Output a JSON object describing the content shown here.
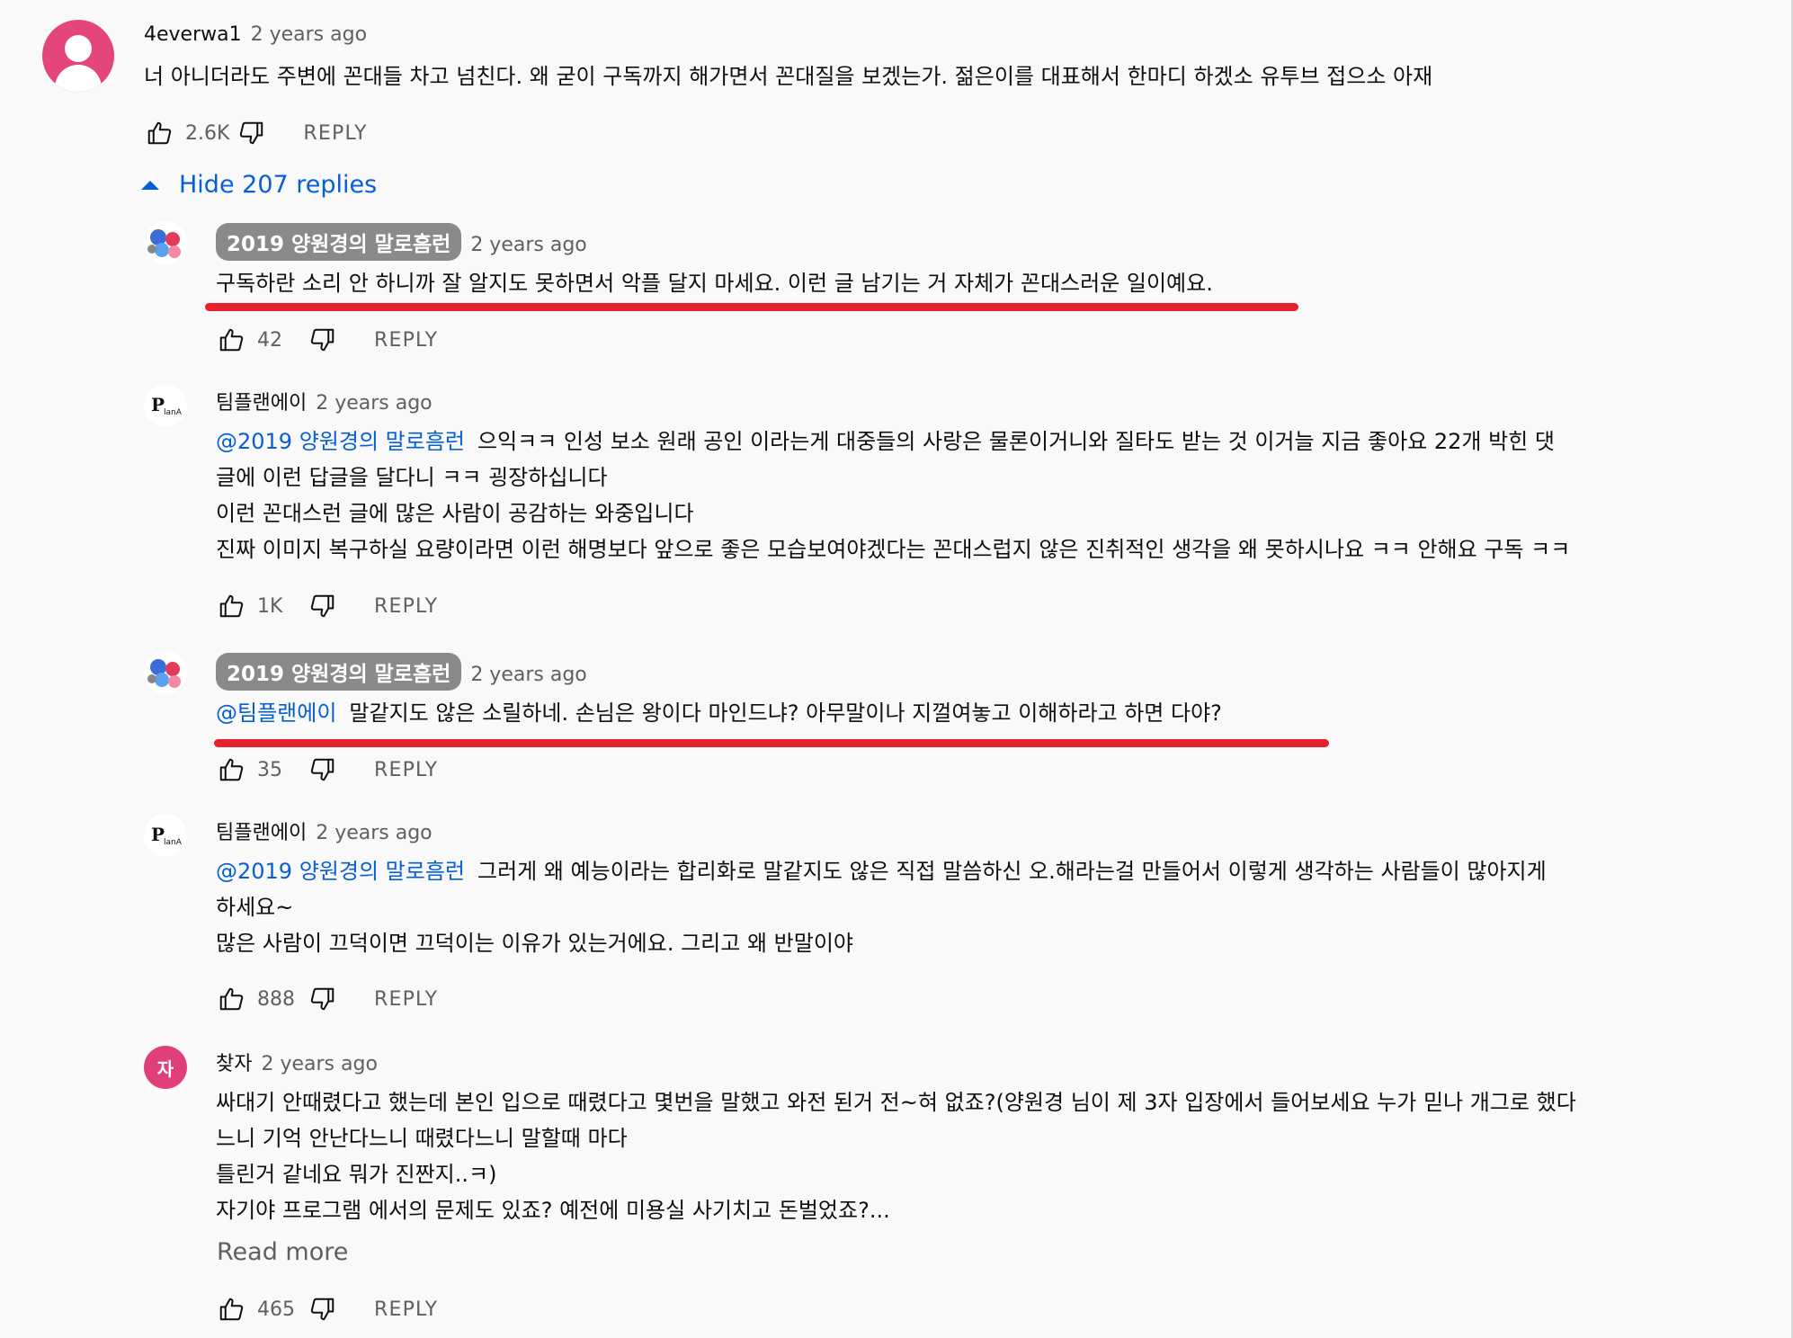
{
  "colors": {
    "link": "#065fd4",
    "annotation": "#e8202b",
    "muted": "#606060",
    "badge": "#8a8a8a"
  },
  "reply_label": "REPLY",
  "thread": {
    "author": "4everwa1",
    "time": "2 years ago",
    "text": "너 아니더라도 주변에 꼰대들 차고 넘친다. 왜 굳이 구독까지 해가면서 꼰대질을 보겠는가. 젊은이를 대표해서 한마디 하겠소 유투브 접으소 아재",
    "likes": "2.6K",
    "hide_replies_label": "Hide 207 replies"
  },
  "replies": [
    {
      "author": "2019 양원경의 말로흠런",
      "time": "2 years ago",
      "mention": "",
      "lines": [
        "구독하란 소리 안 하니까  잘 알지도 못하면서 악플 달지 마세요. 이런 글 남기는 거 자체가 꼰대스러운 일이예요."
      ],
      "likes": "42"
    },
    {
      "author": "팀플랜에이",
      "time": "2 years ago",
      "mention": "@2019 양원경의 말로흠런",
      "lines": [
        "으익ㅋㅋ 인성 보소 원래 공인 이라는게 대중들의 사랑은 물론이거니와 질타도 받는 것 이거늘 지금 좋아요 22개 박힌 댓",
        "글에 이런 답글을 달다니 ㅋㅋ 굉장하십니다",
        "이런 꼰대스런 글에 많은 사람이 공감하는 와중입니다",
        "진짜 이미지 복구하실 요량이라면 이런 해명보다 앞으로 좋은 모습보여야겠다는 꼰대스럽지 않은 진취적인 생각을 왜 못하시나요 ㅋㅋ 안해요 구독 ㅋㅋ"
      ],
      "likes": "1K"
    },
    {
      "author": "2019 양원경의 말로흠런",
      "time": "2 years ago",
      "mention": "@팀플랜에이",
      "lines": [
        "말같지도 않은 소릴하네. 손님은 왕이다 마인드냐? 아무말이나 지껄여놓고 이해하라고 하면 다야?"
      ],
      "likes": "35"
    },
    {
      "author": "팀플랜에이",
      "time": "2 years ago",
      "mention": "@2019 양원경의 말로흠런",
      "lines": [
        "그러게 왜 예능이라는 합리화로 말같지도 않은 직접 말씀하신 오.해라는걸 만들어서 이렇게 생각하는 사람들이 많아지게",
        "하세요~",
        "많은 사람이 끄덕이면 끄덕이는 이유가 있는거에요. 그리고 왜 반말이야"
      ],
      "likes": "888"
    },
    {
      "author": "찾자",
      "avatar_letter": "자",
      "time": "2 years ago",
      "mention": "",
      "lines": [
        "싸대기 안때렸다고 했는데 본인 입으로 때렸다고 몇번을 말했고 와전 된거 전~혀 없죠?(양원경 님이 제 3자 입장에서 들어보세요 누가 믿나 개그로 했다",
        "느니 기억 안난다느니 때렸다느니 말할때 마다",
        "틀린거 같네요 뭐가 진짠지..ㅋ)",
        "자기야 프로그램 에서의 문제도 있죠? 예전에 미용실 사기치고 돈벌었죠?..."
      ],
      "read_more": "Read more",
      "likes": "465"
    }
  ]
}
